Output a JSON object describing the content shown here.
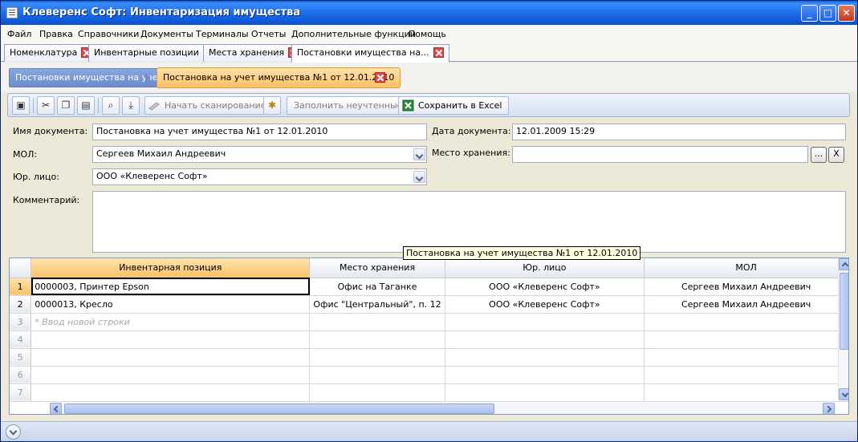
{
  "window": {
    "title": "Клеверенс Софт: Инвентаризация имущества",
    "minimize_icon": "minimize-icon",
    "maximize_icon": "maximize-icon",
    "close_icon": "close-icon"
  },
  "menu": [
    "Файл",
    "Правка",
    "Справочники",
    "Документы",
    "Терминалы",
    "Отчеты",
    "Дополнительные функции",
    "Помощь"
  ],
  "tabs": [
    {
      "label": "Номенклатура"
    },
    {
      "label": "Инвентарные позиции"
    },
    {
      "label": "Места хранения"
    },
    {
      "label": "Постановки имущества на..."
    }
  ],
  "breadcrumb": {
    "parent": "Постановки имущества на учет",
    "current": "Постановка на учет имущества №1 от 12.01.2010"
  },
  "toolbar": {
    "icons": [
      "save-icon",
      "cut-icon",
      "copy-icon",
      "paste-icon",
      "find-icon",
      "import-icon",
      "settings-icon"
    ],
    "start_scan": "Начать сканирование",
    "fill_unaccounted": "Заполнить неучтенные",
    "save_excel": "Сохранить в Excel"
  },
  "form": {
    "doc_name_label": "Имя документа:",
    "doc_name_value": "Постановка на учет имущества №1 от 12.01.2010",
    "doc_date_label": "Дата документа:",
    "doc_date_value": "12.01.2009 15:29",
    "mol_label": "МОЛ:",
    "mol_value": "Сергеев Михаил Андреевич",
    "storage_label": "Место хранения:",
    "storage_value": "",
    "browse_button": "...",
    "clear_button": "X",
    "legal_label": "Юр. лицо:",
    "legal_value": "ООО «Клеверенс Софт»",
    "comment_label": "Комментарий:",
    "comment_value": ""
  },
  "tooltip": "Постановка на учет имущества №1 от 12.01.2010",
  "grid": {
    "columns": [
      "Инвентарная позиция",
      "Место хранения",
      "Юр. лицо",
      "МОЛ"
    ],
    "rows": [
      {
        "num": "1",
        "cells": [
          "0000003, Принтер Epson",
          "Офис на Таганке",
          "ООО «Клеверенс Софт»",
          "Сергеев Михаил Андреевич"
        ]
      },
      {
        "num": "2",
        "cells": [
          "0000013, Кресло",
          "Офис \"Центральный\", п. 12",
          "ООО «Клеверенс Софт»",
          "Сергеев Михаил Андреевич"
        ]
      },
      {
        "num": "3",
        "cells": [
          "* Ввод новой строки",
          "",
          "",
          ""
        ]
      },
      {
        "num": "4",
        "cells": [
          "",
          "",
          "",
          ""
        ]
      },
      {
        "num": "5",
        "cells": [
          "",
          "",
          "",
          ""
        ]
      },
      {
        "num": "6",
        "cells": [
          "",
          "",
          "",
          ""
        ]
      },
      {
        "num": "7",
        "cells": [
          "",
          "",
          "",
          ""
        ]
      }
    ]
  }
}
